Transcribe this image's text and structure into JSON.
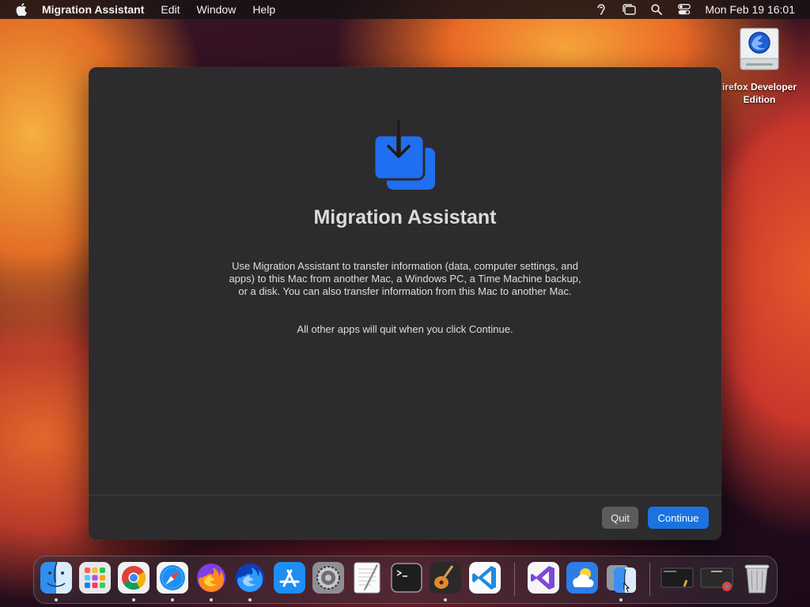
{
  "menubar": {
    "app_name": "Migration Assistant",
    "items": [
      "Edit",
      "Window",
      "Help"
    ],
    "status_icons": [
      "hearing-icon",
      "stage-manager-icon",
      "spotlight-search-icon",
      "control-center-icon"
    ],
    "clock": "Mon Feb 19  16:01"
  },
  "desktop": {
    "icon_label_line1": "irefox Developer",
    "icon_label_line2": "Edition"
  },
  "window": {
    "title": "Migration Assistant",
    "description": "Use Migration Assistant to transfer information (data, computer settings, and apps) to this Mac from another Mac, a Windows PC, a Time Machine backup, or a disk. You can also transfer information from this Mac to another Mac.",
    "note": "All other apps will quit when you click Continue.",
    "quit_label": "Quit",
    "continue_label": "Continue"
  },
  "dock": {
    "apps": [
      "Finder",
      "Launchpad",
      "Google Chrome",
      "Safari",
      "Firefox",
      "Firefox Developer Edition",
      "App Store",
      "System Settings",
      "TextEdit",
      "Terminal",
      "GarageBand",
      "Visual Studio Code",
      "Visual Studio",
      "Weather",
      "Migration Assistant",
      "Recent Window 1",
      "Recent Window 2",
      "Trash"
    ]
  },
  "colors": {
    "accent": "#1a73e0",
    "window_bg": "#2c2c2e"
  }
}
